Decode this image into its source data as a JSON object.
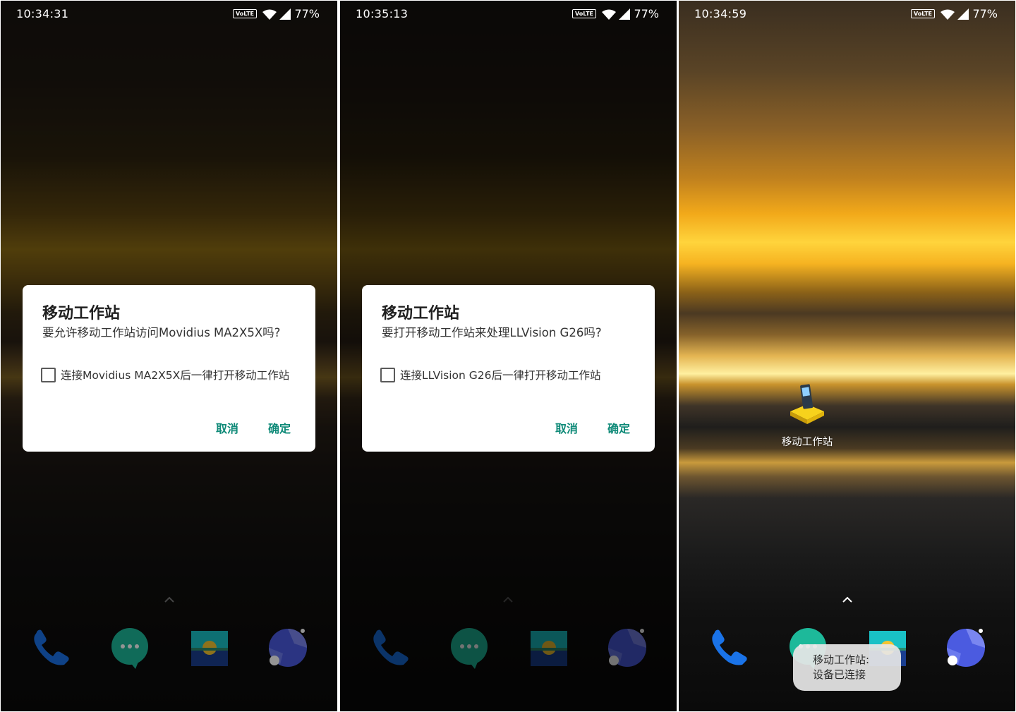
{
  "screens": [
    {
      "status": {
        "time": "10:34:31",
        "network": "VoLTE",
        "battery": "77%"
      },
      "dialog": {
        "title": "移动工作站",
        "message": "要允许移动工作站访问Movidius MA2X5X吗?",
        "checkbox_label": "连接Movidius MA2X5X后一律打开移动工作站",
        "cancel_label": "取消",
        "ok_label": "确定"
      }
    },
    {
      "status": {
        "time": "10:35:13",
        "network": "VoLTE",
        "battery": "77%"
      },
      "dialog": {
        "title": "移动工作站",
        "message": "要打开移动工作站来处理LLVision G26吗?",
        "checkbox_label": "连接LLVision G26后一律打开移动工作站",
        "cancel_label": "取消",
        "ok_label": "确定"
      }
    },
    {
      "status": {
        "time": "10:34:59",
        "network": "VoLTE",
        "battery": "77%"
      },
      "app_icon_label": "移动工作站",
      "toast": {
        "line1": "移动工作站:",
        "line2": "设备已连接"
      }
    }
  ],
  "dock": {
    "icons": [
      "phone-icon",
      "messages-icon",
      "gallery-icon",
      "browser-icon"
    ]
  },
  "colors": {
    "dialog_button": "#0f8a78",
    "phone": "#1a73e8",
    "messages": "#1db99a",
    "gallery_top": "#19c1c6",
    "gallery_bottom": "#1a3e8f",
    "browser": "#4b5be0"
  }
}
